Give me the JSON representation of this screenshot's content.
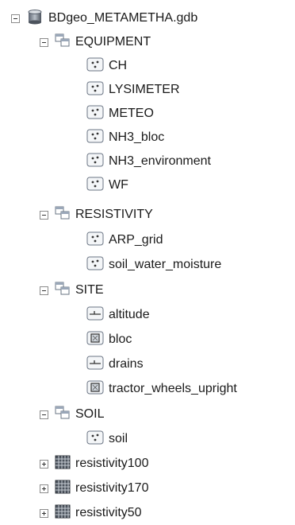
{
  "tree": {
    "root": {
      "label": "BDgeo_METAMETHA.gdb",
      "icon": "geodatabase-icon",
      "expanded": true
    },
    "equipment": {
      "label": "EQUIPMENT",
      "icon": "feature-dataset-icon",
      "expanded": true,
      "items": [
        {
          "label": "CH",
          "icon": "point-feature-class-icon"
        },
        {
          "label": "LYSIMETER",
          "icon": "point-feature-class-icon"
        },
        {
          "label": "METEO",
          "icon": "point-feature-class-icon"
        },
        {
          "label": "NH3_bloc",
          "icon": "point-feature-class-icon"
        },
        {
          "label": "NH3_environment",
          "icon": "point-feature-class-icon"
        },
        {
          "label": "WF",
          "icon": "point-feature-class-icon"
        }
      ]
    },
    "resistivity": {
      "label": "RESISTIVITY",
      "icon": "feature-dataset-icon",
      "expanded": true,
      "items": [
        {
          "label": "ARP_grid",
          "icon": "point-feature-class-icon"
        },
        {
          "label": "soil_water_moisture",
          "icon": "point-feature-class-icon"
        }
      ]
    },
    "site": {
      "label": "SITE",
      "icon": "feature-dataset-icon",
      "expanded": true,
      "items": [
        {
          "label": "altitude",
          "icon": "line-feature-class-icon"
        },
        {
          "label": "bloc",
          "icon": "polygon-feature-class-icon"
        },
        {
          "label": "drains",
          "icon": "line-feature-class-icon"
        },
        {
          "label": "tractor_wheels_upright",
          "icon": "polygon-feature-class-icon"
        }
      ]
    },
    "soil": {
      "label": "SOIL",
      "icon": "feature-dataset-icon",
      "expanded": true,
      "items": [
        {
          "label": "soil",
          "icon": "point-feature-class-icon"
        }
      ]
    },
    "rasters": [
      {
        "label": "resistivity100",
        "icon": "raster-dataset-icon",
        "expanded": false
      },
      {
        "label": "resistivity170",
        "icon": "raster-dataset-icon",
        "expanded": false
      },
      {
        "label": "resistivity50",
        "icon": "raster-dataset-icon",
        "expanded": false
      }
    ]
  }
}
